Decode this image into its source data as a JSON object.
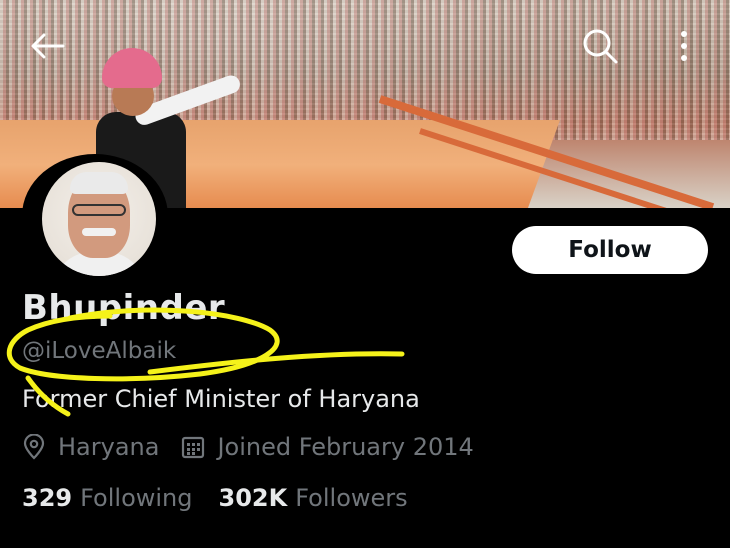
{
  "profile": {
    "name": "Bhupinder",
    "handle": "@iLoveAlbaik",
    "bio": "Former Chief Minister of Haryana",
    "location": "Haryana",
    "joined": "Joined February 2014",
    "following_count": "329",
    "following_label": "Following",
    "followers_count": "302K",
    "followers_label": "Followers"
  },
  "actions": {
    "follow_label": "Follow"
  },
  "icons": {
    "back": "back-arrow-icon",
    "search": "search-icon",
    "more": "more-vertical-icon",
    "location": "location-pin-icon",
    "calendar": "calendar-icon"
  },
  "colors": {
    "background": "#000000",
    "primary_text": "#e7e9ea",
    "secondary_text": "#71767b",
    "follow_button_bg": "#ffffff",
    "annotation": "#f5f21a"
  }
}
